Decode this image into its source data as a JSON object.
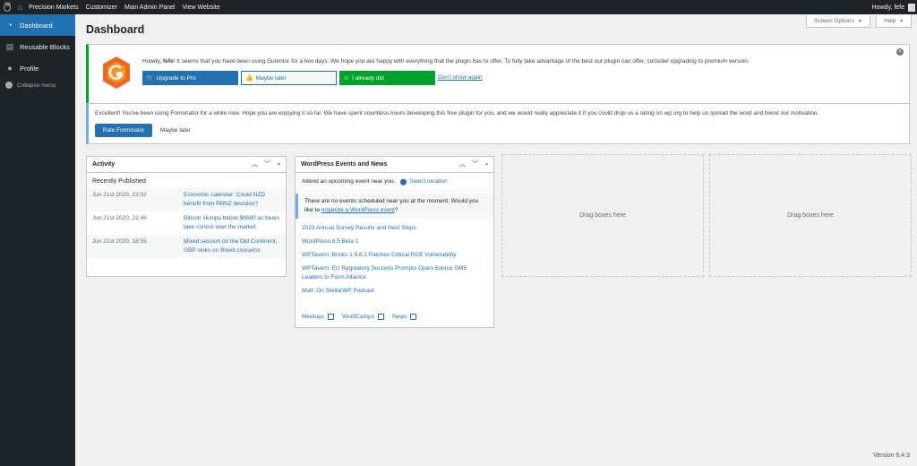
{
  "admin_bar": {
    "site_name": "Precision Markets",
    "customizer": "Customizer",
    "main_admin_panel": "Main Admin Panel",
    "view_website": "View Website",
    "howdy": "Howdy, fefe"
  },
  "sidebar": {
    "items": [
      {
        "label": "Dashboard",
        "icon": "dashboard-icon",
        "active": true
      },
      {
        "label": "Reusable Blocks",
        "icon": "blocks-icon",
        "active": false
      },
      {
        "label": "Profile",
        "icon": "user-icon",
        "active": false
      },
      {
        "label": "Collapse menu",
        "icon": "collapse-icon",
        "active": false
      }
    ]
  },
  "header": {
    "title": "Dashboard",
    "screen_options": "Screen Options",
    "help": "Help"
  },
  "gutentor_notice": {
    "greeting_prefix": "Howdy, ",
    "user": "fefe",
    "message": "! It seems that you have been using Gutentor for a few days. We hope you are happy with everything that the plugin has to offer. To fully take advantage of the best our plugin can offer, consider upgrading to premium version.",
    "upgrade_label": "Upgrade to Pro",
    "later_label": "Maybe later",
    "did_label": "I already did",
    "dont_show_label": "Don't show again"
  },
  "forminator_notice": {
    "message": "Excellent! You've been using Forminator for a while now. Hope you are enjoying it so far. We have spent countless hours developing this free plugin for you, and we would really appreciate it if you could drop us a rating on wp.org to help us spread the word and boost our motivation.",
    "rate_label": "Rate Forminator",
    "maybe_label": "Maybe later"
  },
  "activity": {
    "title": "Activity",
    "subtitle": "Recently Published",
    "rows": [
      {
        "date": "Jun 21st 2020, 22:02",
        "title": "Economic calendar: Could NZD benefit from RBNZ decision?"
      },
      {
        "date": "Jun 21st 2020, 21:46",
        "title": "Bitcoin slumps below $6680 as bears take control over the market"
      },
      {
        "date": "Jun 21st 2020, 18:55",
        "title": "Mixed session on the Old Continent, GBP sinks on Brexit concerns"
      }
    ]
  },
  "events": {
    "title": "WordPress Events and News",
    "attend": "Attend an upcoming event near you.",
    "select_location": "Select location",
    "none_text": "There are no events scheduled near you at the moment. Would you like to ",
    "none_link": "organize a WordPress event",
    "none_suffix": "?",
    "news": [
      "2023 Annual Survey Results and Next Steps",
      "WordPress 6.5 Beta 1",
      "WPTavern: Bricks 1.9.6.1 Patches Critical RCE Vulnerability",
      "WPTavern: EU Regulatory Success Prompts Open-Source SMS Leaders to Form Alliance",
      "Matt: On StellarWP Podcast"
    ],
    "footer": [
      "Meetups",
      "WordCamps",
      "News"
    ]
  },
  "dropzones": {
    "label": "Drag boxes here"
  },
  "footer": {
    "version": "Version 6.4.3"
  },
  "colors": {
    "admin_dark": "#1d2327",
    "accent_blue": "#2271b1",
    "success_green": "#00a32a",
    "gutentor_orange": "#f26522"
  }
}
